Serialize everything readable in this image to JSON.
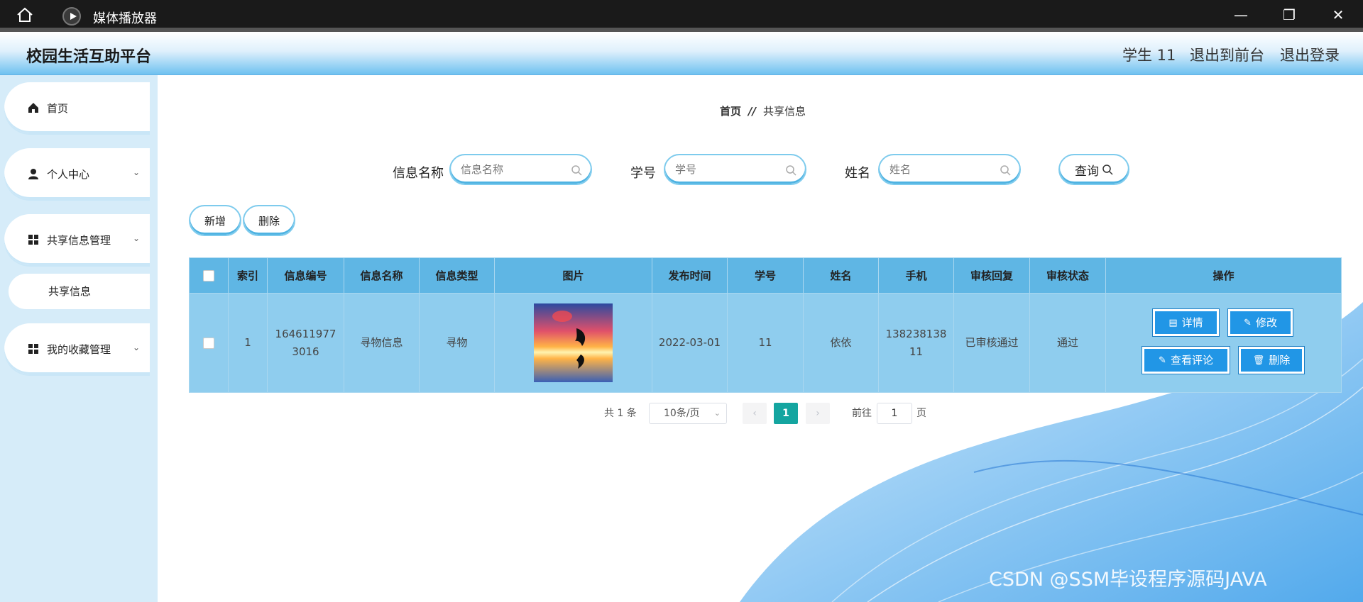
{
  "window": {
    "title": "媒体播放器",
    "minimize": "—",
    "maximize": "❐",
    "close": "✕"
  },
  "header": {
    "title": "校园生活互助平台",
    "user": "学生 11",
    "back_to_front": "退出到前台",
    "logout": "退出登录"
  },
  "sidebar": {
    "items": [
      {
        "label": "首页",
        "icon": "home-icon"
      },
      {
        "label": "个人中心",
        "icon": "user-icon"
      },
      {
        "label": "共享信息管理",
        "icon": "grid-icon"
      },
      {
        "label": "我的收藏管理",
        "icon": "grid-icon"
      }
    ],
    "sub_item": "共享信息"
  },
  "breadcrumb": {
    "home": "首页",
    "sep": "//",
    "current": "共享信息"
  },
  "search": {
    "name_label": "信息名称",
    "name_placeholder": "信息名称",
    "id_label": "学号",
    "id_placeholder": "学号",
    "person_label": "姓名",
    "person_placeholder": "姓名",
    "query": "查询"
  },
  "actions": {
    "add": "新增",
    "delete": "删除"
  },
  "table": {
    "headers": [
      "索引",
      "信息编号",
      "信息名称",
      "信息类型",
      "图片",
      "发布时间",
      "学号",
      "姓名",
      "手机",
      "审核回复",
      "审核状态",
      "操作"
    ],
    "rows": [
      {
        "index": "1",
        "code": "1646119773016",
        "name": "寻物信息",
        "type": "寻物",
        "time": "2022-03-01",
        "student_id": "11",
        "person": "依依",
        "phone": "13823813811",
        "reply": "已审核通过",
        "status": "通过"
      }
    ],
    "ops": {
      "detail": "详情",
      "edit": "修改",
      "comments": "查看评论",
      "delete": "删除"
    }
  },
  "pagination": {
    "total": "共 1 条",
    "page_size": "10条/页",
    "current": "1",
    "goto_prefix": "前往",
    "goto_value": "1",
    "goto_suffix": "页"
  },
  "watermark": "CSDN @SSM毕设程序源码JAVA",
  "colors": {
    "header_blue": "#6ec1f0",
    "sidebar_bg": "#d6ecf9",
    "table_header": "#5fb6e4",
    "table_row": "#8fcdee",
    "op_button": "#2196e6",
    "pager_active": "#14a5a0"
  }
}
